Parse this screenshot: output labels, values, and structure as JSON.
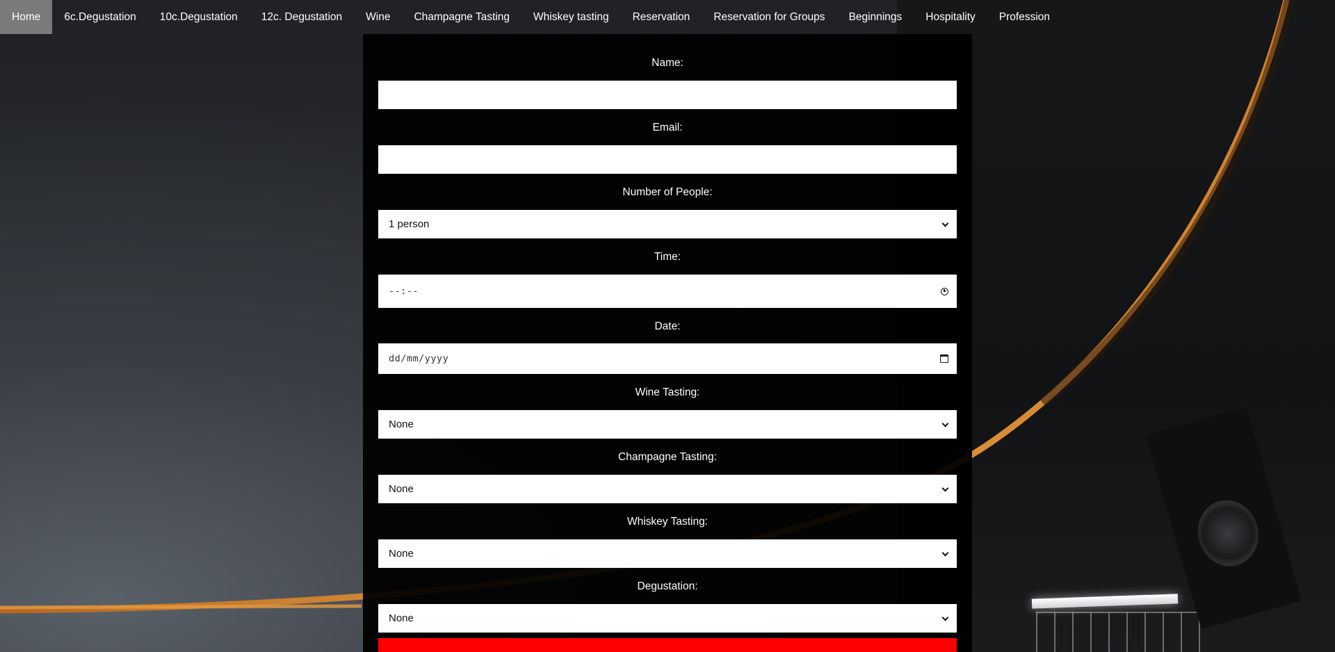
{
  "nav": {
    "items": [
      {
        "label": "Home",
        "active": true
      },
      {
        "label": "6c.Degustation"
      },
      {
        "label": "10c.Degustation"
      },
      {
        "label": "12c. Degustation"
      },
      {
        "label": "Wine"
      },
      {
        "label": "Champagne Tasting"
      },
      {
        "label": "Whiskey tasting"
      },
      {
        "label": "Reservation"
      },
      {
        "label": "Reservation for Groups"
      },
      {
        "label": "Beginnings"
      },
      {
        "label": "Hospitality"
      },
      {
        "label": "Profession"
      }
    ]
  },
  "form": {
    "name": {
      "label": "Name:",
      "value": ""
    },
    "email": {
      "label": "Email:",
      "value": ""
    },
    "people": {
      "label": "Number of People:",
      "value": "1 person"
    },
    "time": {
      "label": "Time:",
      "placeholder": "--:--"
    },
    "date": {
      "label": "Date:",
      "placeholder": "dd/mm/yyyy"
    },
    "wine": {
      "label": "Wine Tasting:",
      "value": "None"
    },
    "champagne": {
      "label": "Champagne Tasting:",
      "value": "None"
    },
    "whiskey": {
      "label": "Whiskey Tasting:",
      "value": "None"
    },
    "degustation": {
      "label": "Degustation:",
      "value": "None"
    }
  },
  "colors": {
    "nav_active": "#7a7a7a",
    "panel": "#000000",
    "submit": "#ff0000",
    "accent_orange": "#e08a2e"
  }
}
